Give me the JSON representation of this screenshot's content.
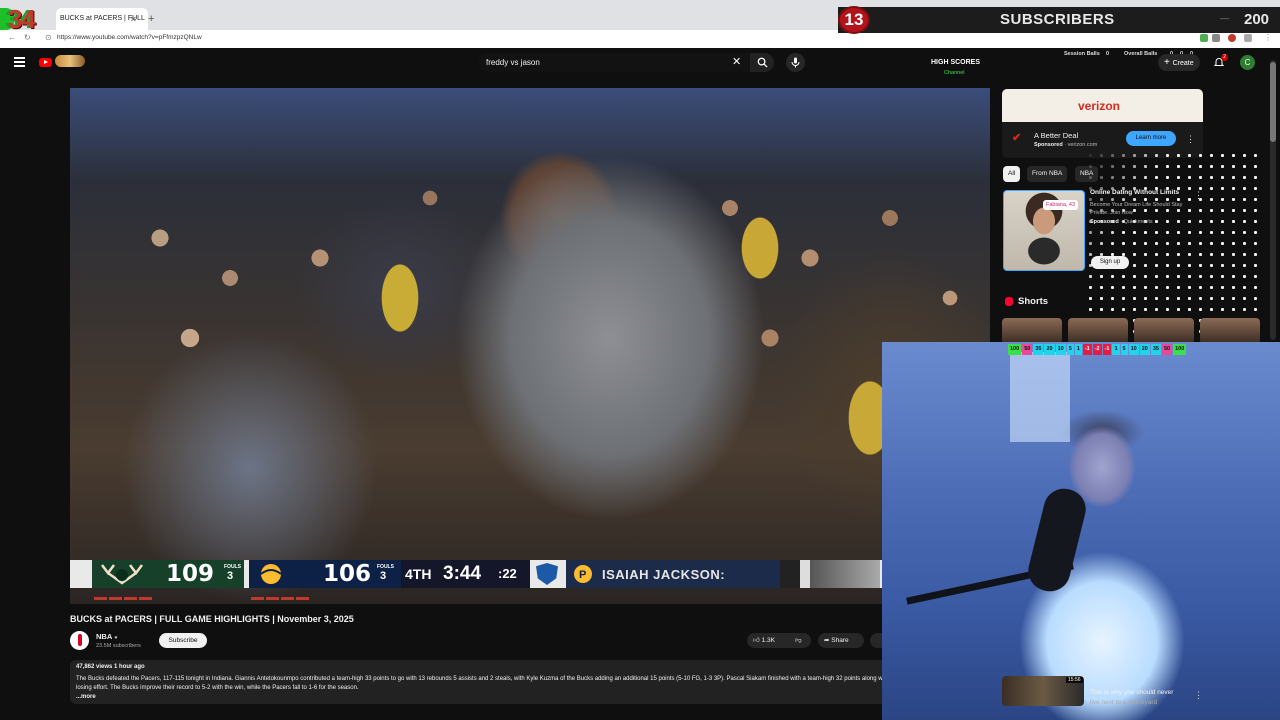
{
  "browser": {
    "tab_title": "BUCKS at PACERS | FULL",
    "tab_close": "✕",
    "new_tab": "+",
    "url": "https://www.youtube.com/watch?v=pFfmzpzQNLw",
    "win_min": "—",
    "win_max": "□",
    "win_close": "✕"
  },
  "overlay": {
    "counter": "34",
    "sub_badge": "13",
    "sub_label": "SUBSCRIBERS",
    "sub_count": "200",
    "sub_minus": "—"
  },
  "header": {
    "search_value": "freddy vs jason",
    "high_scores_title": "HIGH SCORES",
    "high_scores_sub": "Channel",
    "session_balls_label": "Session Balls",
    "session_balls_value": "0",
    "overall_balls_label": "Overall Balls",
    "overall_balls_v1": "0",
    "overall_balls_v2": "0",
    "overall_balls_v3": "0",
    "create_label": "Create",
    "notif_count": "2",
    "avatar_letter": "C"
  },
  "scorebug": {
    "away_score": "109",
    "away_fouls": "3",
    "home_score": "106",
    "home_fouls": "3",
    "fouls_label": "FOULS",
    "quarter": "4TH",
    "clock": "3:44",
    "shot_clock": ":22",
    "player": "ISAIAH JACKSON:"
  },
  "video": {
    "title": "BUCKS at PACERS | FULL GAME HIGHLIGHTS | November 3, 2025",
    "channel": "NBA",
    "subscribers": "23.5M subscribers",
    "subscribe": "Subscribe",
    "likes": "1.3K",
    "share": "Share",
    "views_time": "47,862 views  1 hour ago",
    "description": "The Bucks defeated the Pacers, 117-115 tonight in Indiana. Giannis Antetokounmpo contributed a team-high 33 points to go with 13 rebounds 5 assists and 2 steals, with Kyle Kuzma of the Bucks adding an additional 15 points (5-10 FG, 1-3 3P). Pascal Siakam finished with a team-high 32 points along with 8 assists for the Pacers in the losing effort. The Bucks improve their record to 5-2 with the win, while the Pacers fall to 1-6 for the season.",
    "more": "...more"
  },
  "sidebar": {
    "ad_brand": "verizon",
    "ad_title": "A Better Deal",
    "ad_sponsored": "Sponsored",
    "ad_domain": "· verizon.com",
    "ad_cta": "Learn more",
    "chips": [
      "All",
      "From NBA",
      "NBA"
    ],
    "ad2_tag": "Fabiana, 43",
    "ad2_title": "Online Dating Without Limits",
    "ad2_desc": "Become Your Dream Life Should Stay Private. Join Now",
    "ad2_sponsored": "Sponsored",
    "ad2_domain": "· Quickmeets",
    "ad2_cta": "Sign up",
    "shorts": "Shorts",
    "rec_duration": "15:56",
    "rec_title": "This is why you should never",
    "rec_title2": "live next to a graveyard"
  },
  "meter": [
    "100",
    "50",
    "35",
    "20",
    "10",
    "5",
    "1",
    "-1",
    "-2",
    "-1",
    "1",
    "5",
    "10",
    "20",
    "35",
    "50",
    "100"
  ],
  "colors": {
    "meter_green": "#39e04b",
    "meter_cyan": "#22d3ee",
    "meter_red": "#e11d48",
    "meter_pink": "#ec4899",
    "bucks_green": "#17402a",
    "pacers_navy": "#0d2146"
  }
}
